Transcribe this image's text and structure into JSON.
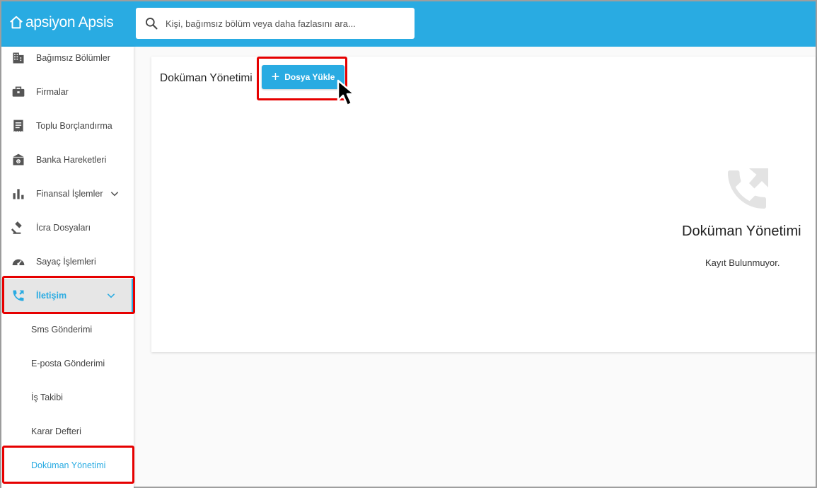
{
  "header": {
    "logo_text": "apsiyon Apsis",
    "search_placeholder": "Kişi, bağımsız bölüm veya daha fazlasını ara..."
  },
  "sidebar": {
    "items": [
      {
        "label": "Bağımsız Bölümler",
        "icon": "building-icon"
      },
      {
        "label": "Firmalar",
        "icon": "briefcase-icon"
      },
      {
        "label": "Toplu Borçlandırma",
        "icon": "receipt-icon"
      },
      {
        "label": "Banka Hareketleri",
        "icon": "bank-icon"
      },
      {
        "label": "Finansal İşlemler",
        "icon": "bar-chart-icon"
      },
      {
        "label": "İcra Dosyaları",
        "icon": "gavel-icon"
      },
      {
        "label": "Sayaç İşlemleri",
        "icon": "meter-icon"
      },
      {
        "label": "İletişim",
        "icon": "phone-forward-icon"
      }
    ],
    "subitems": [
      {
        "label": "Sms Gönderimi"
      },
      {
        "label": "E-posta Gönderimi"
      },
      {
        "label": "İş Takibi"
      },
      {
        "label": "Karar Defteri"
      },
      {
        "label": "Doküman Yönetimi"
      }
    ]
  },
  "main": {
    "title": "Doküman Yönetimi",
    "upload_button": "Dosya Yükle",
    "empty_title": "Doküman Yönetimi",
    "empty_message": "Kayıt Bulunmuyor."
  },
  "colors": {
    "accent": "#29abe2",
    "highlight": "#e60000"
  }
}
